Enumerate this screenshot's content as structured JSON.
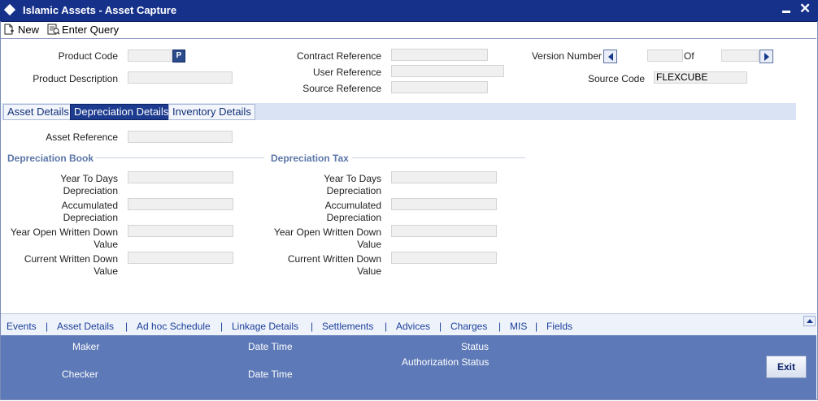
{
  "window": {
    "title": "Islamic Assets - Asset Capture",
    "minimize_symbol": "▬",
    "close_symbol": "✕"
  },
  "toolbar": {
    "new_label": "New",
    "enter_query_label": "Enter Query"
  },
  "header": {
    "product_code_label": "Product Code",
    "product_code_value": "",
    "product_lookup_label": "P",
    "product_description_label": "Product Description",
    "product_description_value": "",
    "contract_reference_label": "Contract Reference",
    "contract_reference_value": "",
    "user_reference_label": "User Reference",
    "user_reference_value": "",
    "source_reference_label": "Source Reference",
    "source_reference_value": "",
    "version_number_label": "Version Number",
    "version_current": "",
    "of_label": "Of",
    "version_total": "",
    "source_code_label": "Source Code",
    "source_code_value": "FLEXCUBE"
  },
  "tabs": [
    {
      "label": "Asset Details",
      "active": false
    },
    {
      "label": "Depreciation Details",
      "active": true
    },
    {
      "label": "Inventory Details",
      "active": false
    }
  ],
  "depreciation": {
    "asset_reference_label": "Asset Reference",
    "asset_reference_value": "",
    "book": {
      "title": "Depreciation Book",
      "fields": [
        {
          "label_line1": "Year To Days",
          "label_line2": "Depreciation",
          "value": ""
        },
        {
          "label_line1": "Accumulated",
          "label_line2": "Depreciation",
          "value": ""
        },
        {
          "label_line1": "Year Open Written Down",
          "label_line2": "Value",
          "value": ""
        },
        {
          "label_line1": "Current Written Down",
          "label_line2": "Value",
          "value": ""
        }
      ]
    },
    "tax": {
      "title": "Depreciation Tax",
      "fields": [
        {
          "label_line1": "Year To Days",
          "label_line2": "Depreciation",
          "value": ""
        },
        {
          "label_line1": "Accumulated",
          "label_line2": "Depreciation",
          "value": ""
        },
        {
          "label_line1": "Year Open Written Down",
          "label_line2": "Value",
          "value": ""
        },
        {
          "label_line1": "Current Written Down",
          "label_line2": "Value",
          "value": ""
        }
      ]
    }
  },
  "bottom_links": [
    "Events",
    "Asset Details",
    "Ad hoc Schedule",
    "Linkage Details",
    "Settlements",
    "Advices",
    "Charges",
    "MIS",
    "Fields"
  ],
  "bottom_separator": "|",
  "footer": {
    "maker_label": "Maker",
    "checker_label": "Checker",
    "date_time_label": "Date Time",
    "date_time_label_2": "Date Time",
    "status_label": "Status",
    "authorization_status_label": "Authorization Status",
    "exit_label": "Exit"
  },
  "colors": {
    "titlebar": "#16318a",
    "tab_active": "#1d3c8f",
    "footer": "#5d79b7",
    "link": "#1b3f9a"
  }
}
